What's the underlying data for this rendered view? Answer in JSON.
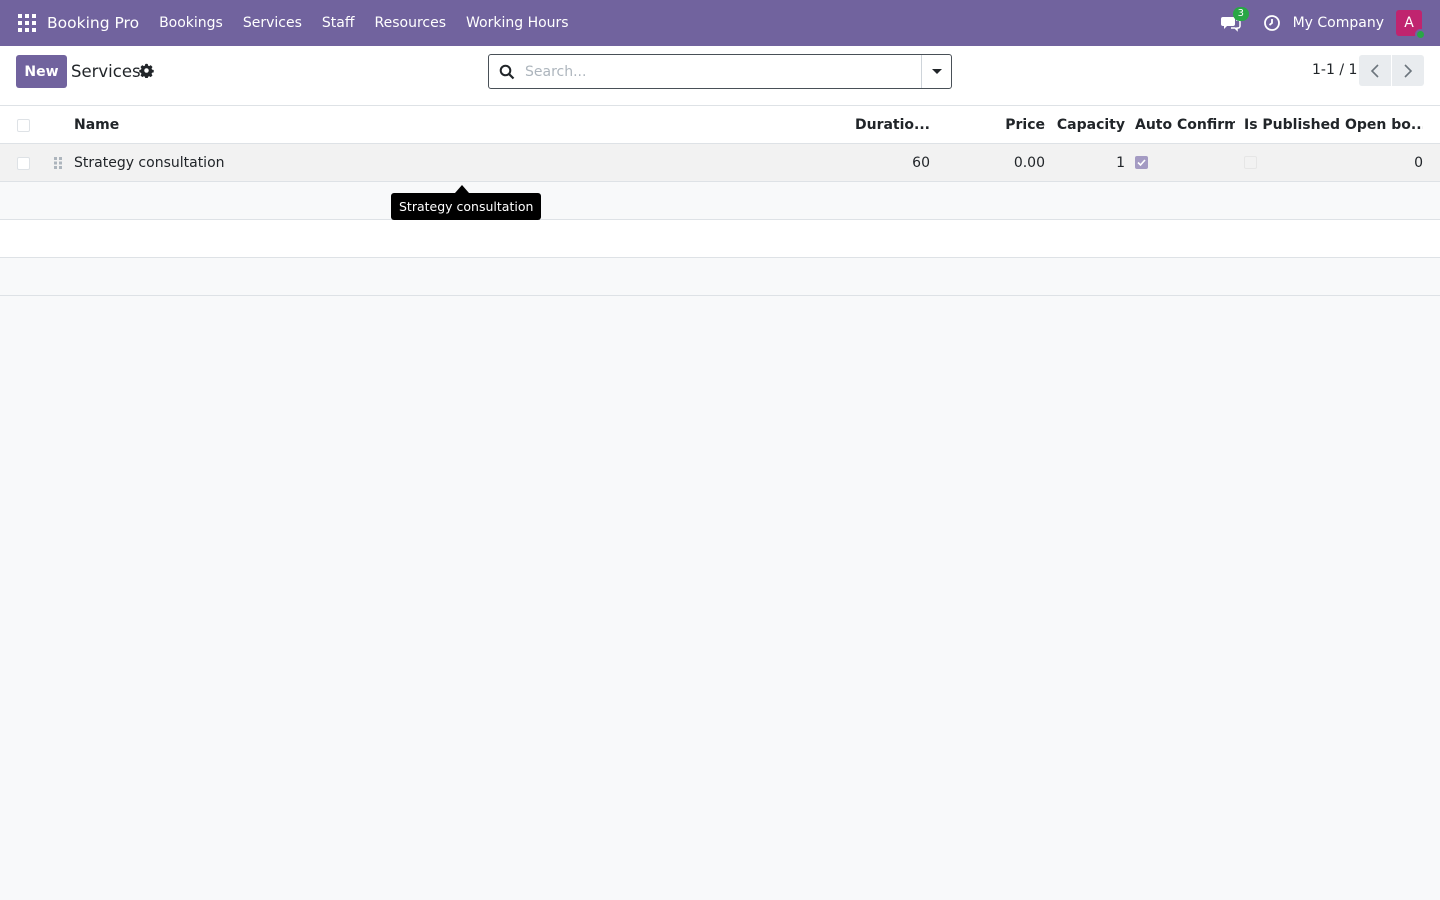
{
  "navbar": {
    "brand": "Booking Pro",
    "menu": [
      "Bookings",
      "Services",
      "Staff",
      "Resources",
      "Working Hours"
    ],
    "chat_count": "3",
    "company": "My Company",
    "avatar_letter": "A",
    "bg_color": "#71639e"
  },
  "control": {
    "new_label": "New",
    "breadcrumb": "Services",
    "search_placeholder": "Search...",
    "pager_text": "1-1 / 1"
  },
  "table": {
    "headers": {
      "name": "Name",
      "duration": "Duratio...",
      "price": "Price",
      "capacity": "Capacity",
      "auto_confirm": "Auto Confirm",
      "is_published": "Is Published",
      "open_bookings": "Open bo..."
    },
    "rows": [
      {
        "name": "Strategy consultation",
        "duration": "60",
        "price": "0.00",
        "capacity": "1",
        "auto_confirm": true,
        "is_published": false,
        "open_bookings": "0"
      }
    ]
  },
  "tooltip": {
    "text": "Strategy consultation"
  }
}
